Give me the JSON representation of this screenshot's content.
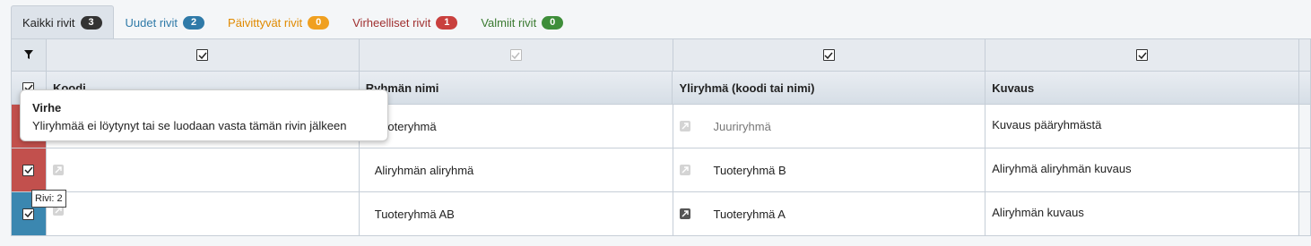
{
  "tabs": [
    {
      "label": "Kaikki rivit",
      "count": "3",
      "active": true,
      "color": "#222222",
      "badge_color": "#333333"
    },
    {
      "label": "Uudet rivit",
      "count": "2",
      "color": "#2f7aa8",
      "badge_color": "#2f7aa8"
    },
    {
      "label": "Päivittyvät rivit",
      "count": "0",
      "color": "#e08a00",
      "badge_color": "#f0a020"
    },
    {
      "label": "Virheelliset rivit",
      "count": "1",
      "color": "#a03030",
      "badge_color": "#c9403e"
    },
    {
      "label": "Valmiit rivit",
      "count": "0",
      "color": "#3a7a30",
      "badge_color": "#3e8e3a"
    }
  ],
  "columns": [
    "Koodi",
    "Ryhmän nimi",
    "Yliryhmä (koodi tai nimi)",
    "Kuvaus"
  ],
  "rows": [
    {
      "status": "error",
      "code": "",
      "name": "Tuoteryhmä",
      "parent": "Juuriryhmä",
      "parent_muted": true,
      "description": "Kuvaus pääryhmästä"
    },
    {
      "status": "error",
      "code": "",
      "name": "Aliryhmän aliryhmä",
      "parent": "Tuoteryhmä B",
      "parent_muted": false,
      "description": "Aliryhmä aliryhmän kuvaus"
    },
    {
      "status": "new",
      "code": "",
      "name": "Tuoteryhmä AB",
      "parent": "Tuoteryhmä A",
      "parent_muted": false,
      "parent_icon_dark": true,
      "description": "Aliryhmän kuvaus"
    }
  ],
  "tooltip": {
    "title": "Virhe",
    "body": "Yliryhmää ei löytynyt tai se luodaan vasta tämän rivin jälkeen"
  },
  "row_tooltip": "Rivi: 2",
  "icons": {
    "filter": "filter-icon",
    "link": "link-icon",
    "check": "check-icon"
  },
  "colors": {
    "error": "#c2504d",
    "new": "#3b87b0"
  }
}
